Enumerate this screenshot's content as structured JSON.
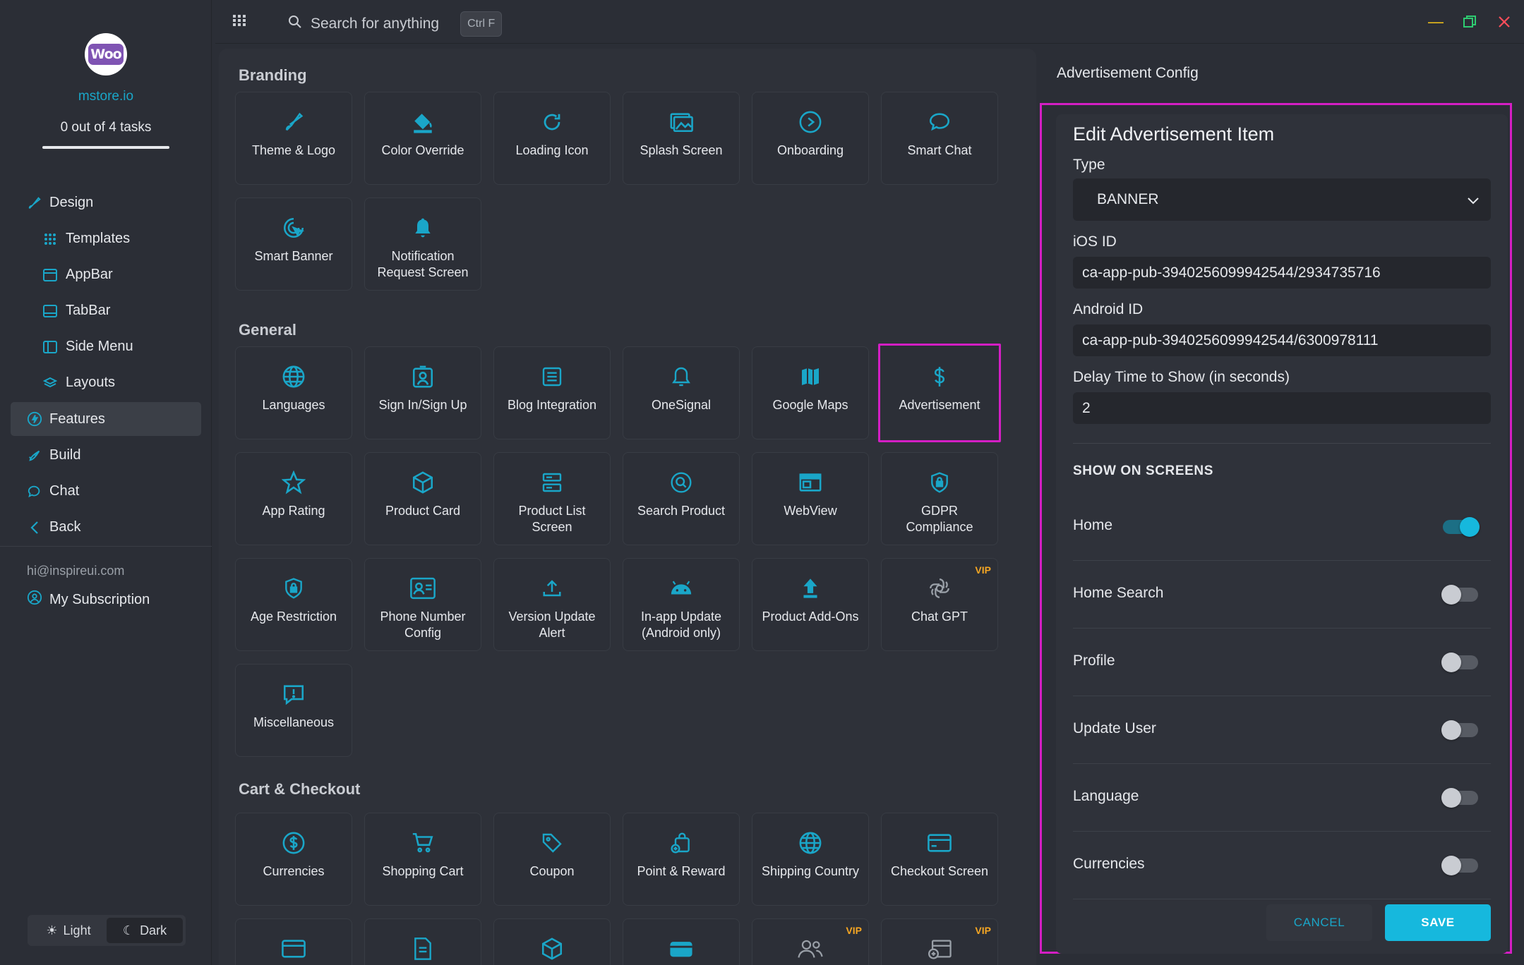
{
  "sidebar": {
    "logo_text": "Woo",
    "store": "mstore.io",
    "tasks": "0 out of 4 tasks",
    "nav": [
      {
        "label": "Design",
        "icon": "brush-icon"
      },
      {
        "label": "Templates",
        "icon": "grid-icon"
      },
      {
        "label": "AppBar",
        "icon": "appbar-icon"
      },
      {
        "label": "TabBar",
        "icon": "tabbar-icon"
      },
      {
        "label": "Side Menu",
        "icon": "side-menu-icon"
      },
      {
        "label": "Layouts",
        "icon": "layers-icon"
      },
      {
        "label": "Features",
        "icon": "bolt-icon"
      },
      {
        "label": "Build",
        "icon": "rocket-icon"
      },
      {
        "label": "Chat",
        "icon": "chat-icon"
      },
      {
        "label": "Back",
        "icon": "chevron-left-icon"
      }
    ],
    "email": "hi@inspireui.com",
    "subscription": "My Subscription",
    "theme": {
      "light": "Light",
      "dark": "Dark"
    }
  },
  "topbar": {
    "search_placeholder": "Search for anything",
    "shortcut": "Ctrl F"
  },
  "sections": {
    "branding": "Branding",
    "general": "General",
    "cart": "Cart & Checkout"
  },
  "cards": {
    "branding": [
      "Theme & Logo",
      "Color Override",
      "Loading Icon",
      "Splash Screen",
      "Onboarding",
      "Smart Chat",
      "Smart Banner",
      "Notification Request Screen"
    ],
    "general": [
      "Languages",
      "Sign In/Sign Up",
      "Blog Integration",
      "OneSignal",
      "Google Maps",
      "Advertisement",
      "App Rating",
      "Product Card",
      "Product List Screen",
      "Search Product",
      "WebView",
      "GDPR Compliance",
      "Age Restriction",
      "Phone Number Config",
      "Version Update Alert",
      "In-app Update (Android only)",
      "Product Add-Ons",
      "Chat GPT",
      "Miscellaneous"
    ],
    "cart": [
      "Currencies",
      "Shopping Cart",
      "Coupon",
      "Point & Reward",
      "Shipping Country",
      "Checkout Screen"
    ],
    "vip_label": "VIP"
  },
  "panel": {
    "title": "Advertisement Config",
    "form_title": "Edit Advertisement Item",
    "type_label": "Type",
    "type_value": "BANNER",
    "ios_label": "iOS ID",
    "ios_value": "ca-app-pub-3940256099942544/2934735716",
    "android_label": "Android ID",
    "android_value": "ca-app-pub-3940256099942544/6300978111",
    "delay_label": "Delay Time to Show (in seconds)",
    "delay_value": "2",
    "show_title": "SHOW ON SCREENS",
    "screens": [
      {
        "label": "Home",
        "on": true
      },
      {
        "label": "Home Search",
        "on": false
      },
      {
        "label": "Profile",
        "on": false
      },
      {
        "label": "Update User",
        "on": false
      },
      {
        "label": "Language",
        "on": false
      },
      {
        "label": "Currencies",
        "on": false
      }
    ],
    "cancel": "CANCEL",
    "save": "SAVE"
  },
  "colors": {
    "accent": "#16b8dd",
    "highlight": "#d41ec4",
    "vip": "#f5a623"
  }
}
